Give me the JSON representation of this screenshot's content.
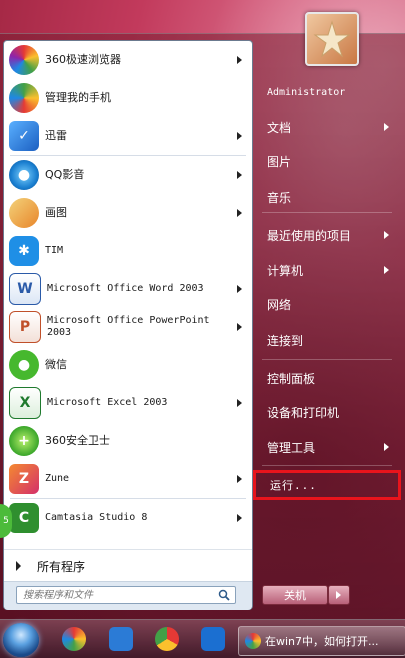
{
  "programs": [
    {
      "label": "360极速浏览器",
      "has_arrow": true,
      "icon": "360-browser-icon"
    },
    {
      "label": "管理我的手机",
      "has_arrow": false,
      "icon": "phone-manager-icon"
    },
    {
      "label": "迅雷",
      "has_arrow": true,
      "icon": "thunder-icon"
    },
    {
      "label": "QQ影音",
      "has_arrow": true,
      "icon": "qqplayer-icon"
    },
    {
      "label": "画图",
      "has_arrow": true,
      "icon": "paint-icon"
    },
    {
      "label": "TIM",
      "has_arrow": false,
      "icon": "tim-icon"
    },
    {
      "label": "Microsoft Office Word 2003",
      "has_arrow": true,
      "icon": "word-icon"
    },
    {
      "label": "Microsoft Office PowerPoint 2003",
      "has_arrow": true,
      "icon": "powerpoint-icon"
    },
    {
      "label": "微信",
      "has_arrow": false,
      "icon": "wechat-icon"
    },
    {
      "label": "Microsoft Excel 2003",
      "has_arrow": true,
      "icon": "excel-icon"
    },
    {
      "label": "360安全卫士",
      "has_arrow": false,
      "icon": "360-safe-icon"
    },
    {
      "label": "Zune",
      "has_arrow": true,
      "icon": "zune-icon"
    },
    {
      "label": "Camtasia Studio 8",
      "has_arrow": true,
      "icon": "camtasia-icon"
    }
  ],
  "all_programs_label": "所有程序",
  "search": {
    "placeholder": "搜索程序和文件"
  },
  "user": {
    "name": "Administrator"
  },
  "right_items": [
    {
      "label": "文档",
      "has_arrow": true
    },
    {
      "label": "图片",
      "has_arrow": false
    },
    {
      "label": "音乐",
      "has_arrow": false
    },
    {
      "label": "最近使用的项目",
      "has_arrow": true
    },
    {
      "label": "计算机",
      "has_arrow": true
    },
    {
      "label": "网络",
      "has_arrow": false
    },
    {
      "label": "连接到",
      "has_arrow": false
    },
    {
      "label": "控制面板",
      "has_arrow": false
    },
    {
      "label": "设备和打印机",
      "has_arrow": false
    },
    {
      "label": "管理工具",
      "has_arrow": true
    },
    {
      "label": "运行...",
      "has_arrow": false
    }
  ],
  "shutdown_label": "关机",
  "taskbar": {
    "active_window_title": "在win7中，如何打开..."
  },
  "side_badge": "5",
  "colors": {
    "highlight_border": "#e8141c",
    "menu_bg": "#ffffff"
  }
}
